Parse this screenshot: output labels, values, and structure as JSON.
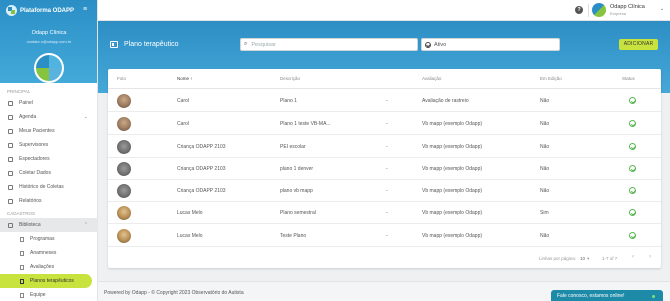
{
  "brand": {
    "name": "Plataforma ODAPP"
  },
  "sidebar": {
    "clinic_name": "Odapp Clínica",
    "clinic_email": "contato.c@odapp.com.br",
    "sections": {
      "principal": "PRINCIPAL",
      "cadastros": "CADASTROS"
    },
    "principal_items": [
      {
        "label": "Painel",
        "icon": "dashboard-icon"
      },
      {
        "label": "Agenda",
        "icon": "calendar-icon"
      },
      {
        "label": "Meus Pacientes",
        "icon": "patients-icon"
      },
      {
        "label": "Supervisores",
        "icon": "supervisor-icon"
      },
      {
        "label": "Espectadores",
        "icon": "viewer-icon"
      },
      {
        "label": "Coletar Dados",
        "icon": "pencil-icon"
      },
      {
        "label": "Histórico de Coletas",
        "icon": "history-icon"
      },
      {
        "label": "Relatórios",
        "icon": "report-icon"
      }
    ],
    "cadastros_items": [
      {
        "label": "Biblioteca",
        "icon": "library-icon"
      }
    ],
    "library_sub": [
      {
        "label": "Programas",
        "icon": "document-icon"
      },
      {
        "label": "Anamneses",
        "icon": "document-icon"
      },
      {
        "label": "Avaliações",
        "icon": "document-icon"
      },
      {
        "label": "Planos terapêuticos",
        "icon": "document-icon"
      },
      {
        "label": "Equipe",
        "icon": "document-icon"
      }
    ]
  },
  "topbar": {
    "help": "?",
    "user_name": "Odapp Clínica",
    "user_role": "Empresa"
  },
  "header": {
    "title": "Plano terapêutico",
    "search_placeholder": "Pesquisar",
    "status_value": "Ativo",
    "add_label": "ADICIONAR"
  },
  "table": {
    "columns": {
      "foto": "Foto",
      "nome": "Nome ↑",
      "descricao": "Descrição",
      "avaliacao": "Avaliação",
      "edicao": "Em Edição",
      "status": "Status"
    },
    "rows": [
      {
        "photo": "adult",
        "nome": "Carol",
        "descricao": "Plano 1",
        "dash": "-",
        "avaliacao": "Avaliação de rastreio",
        "edicao": "Não"
      },
      {
        "photo": "adult",
        "nome": "Carol",
        "descricao": "Plano 1 teste VB-MA...",
        "dash": "-",
        "avaliacao": "Vb mapp (exemplo Odapp)",
        "edicao": "Não"
      },
      {
        "photo": "gray",
        "nome": "Criança ODAPP 2103",
        "descricao": "PEI escolar",
        "dash": "-",
        "avaliacao": "Vb mapp (exemplo Odapp)",
        "edicao": "Não"
      },
      {
        "photo": "gray",
        "nome": "Criança ODAPP 2103",
        "descricao": "plano 1 denver",
        "dash": "-",
        "avaliacao": "Vb mapp (exemplo Odapp)",
        "edicao": "Não"
      },
      {
        "photo": "gray",
        "nome": "Criança ODAPP 2103",
        "descricao": "plano vb mapp",
        "dash": "-",
        "avaliacao": "Vb mapp (exemplo Odapp)",
        "edicao": "Não"
      },
      {
        "photo": "child",
        "nome": "Lucas Melo",
        "descricao": "Plano semestral",
        "dash": "-",
        "avaliacao": "Vb mapp (exemplo Odapp)",
        "edicao": "Sim"
      },
      {
        "photo": "child",
        "nome": "Lucas Melo",
        "descricao": "Teste Plano",
        "dash": "-",
        "avaliacao": "Vb mapp (exemplo Odapp)",
        "edicao": "Não"
      }
    ],
    "pagination": {
      "rows_label": "Linhas por página:",
      "rows_value": "10",
      "range": "1-7 of 7",
      "prev": "‹",
      "next": "›"
    }
  },
  "footer": {
    "text": "Powered by Odapp - © Copyright 2023 Observatório do Autista",
    "chat": "Fale conosco, estamos online!"
  },
  "colors": {
    "primary": "#2b8fc6",
    "accent": "#c9e33e",
    "status_ok": "#5bb552"
  }
}
